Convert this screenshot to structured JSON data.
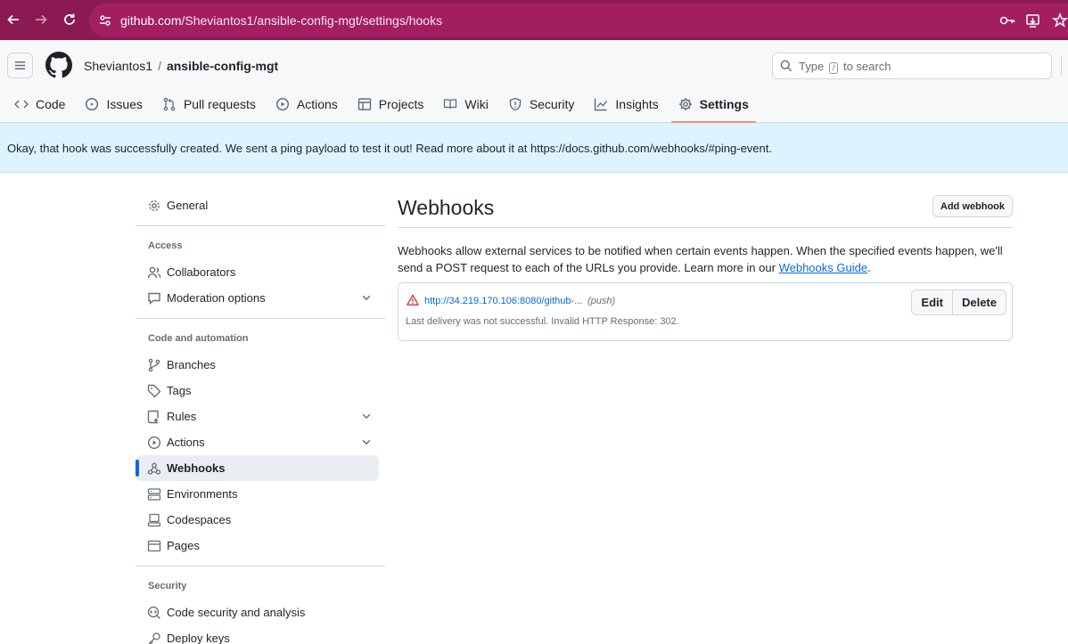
{
  "browser": {
    "url_host": "github.com",
    "url_path": "/Sheviantos1/ansible-config-mgt/settings/hooks"
  },
  "header": {
    "owner": "Sheviantos1",
    "separator": "/",
    "repo": "ansible-config-mgt",
    "search_prefix": "Type",
    "search_key": "/",
    "search_suffix": "to search"
  },
  "tabs": [
    {
      "label": "Code",
      "icon": "code-icon"
    },
    {
      "label": "Issues",
      "icon": "issue-icon"
    },
    {
      "label": "Pull requests",
      "icon": "pull-request-icon"
    },
    {
      "label": "Actions",
      "icon": "play-icon"
    },
    {
      "label": "Projects",
      "icon": "table-icon"
    },
    {
      "label": "Wiki",
      "icon": "book-icon"
    },
    {
      "label": "Security",
      "icon": "shield-icon"
    },
    {
      "label": "Insights",
      "icon": "graph-icon"
    },
    {
      "label": "Settings",
      "icon": "gear-icon"
    }
  ],
  "flash": {
    "message": "Okay, that hook was successfully created. We sent a ping payload to test it out! Read more about it at https://docs.github.com/webhooks/#ping-event."
  },
  "sidebar": {
    "general": "General",
    "access_heading": "Access",
    "collaborators": "Collaborators",
    "moderation": "Moderation options",
    "code_heading": "Code and automation",
    "branches": "Branches",
    "tags": "Tags",
    "rules": "Rules",
    "actions": "Actions",
    "webhooks": "Webhooks",
    "environments": "Environments",
    "codespaces": "Codespaces",
    "pages": "Pages",
    "security_heading": "Security",
    "code_security": "Code security and analysis",
    "deploy_keys": "Deploy keys"
  },
  "main": {
    "title": "Webhooks",
    "add_button": "Add webhook",
    "description": "Webhooks allow external services to be notified when certain events happen. When the specified events happen, we'll send a POST request to each of the URLs you provide. Learn more in our",
    "guide_link": "Webhooks Guide",
    "period": ".",
    "hook": {
      "url": "http://34.219.170.106:8080/github-...",
      "events": "(push)",
      "status": "Last delivery was not successful. Invalid HTTP Response: 302.",
      "edit": "Edit",
      "delete": "Delete"
    }
  }
}
